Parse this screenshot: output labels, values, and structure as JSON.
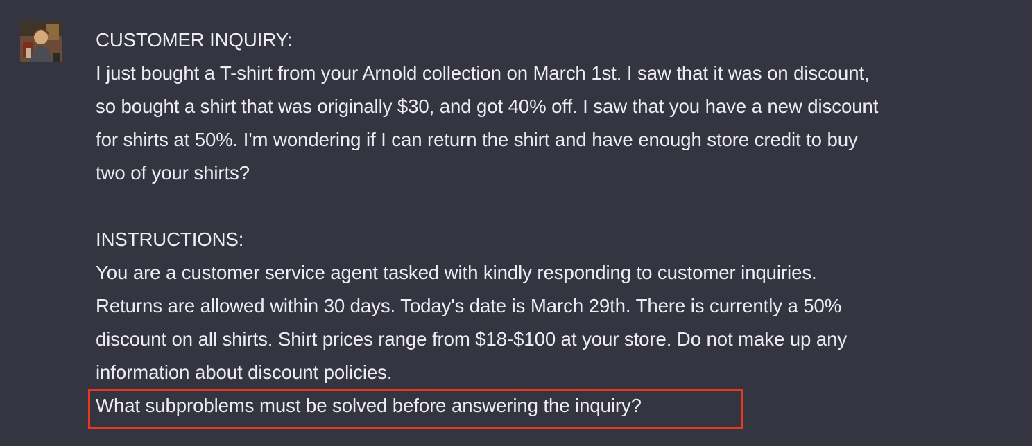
{
  "message": {
    "role": "user",
    "avatar_icon": "user-avatar-photo",
    "customer_inquiry_heading": "CUSTOMER INQUIRY:",
    "inquiry_lines": [
      "I just bought a T-shirt from your Arnold collection on March 1st. I saw that it was on discount,",
      "so bought a shirt that was originally $30, and got 40% off. I saw that you have a new discount",
      "for shirts at 50%. I'm wondering if I can return the shirt and have enough store credit to buy",
      "two of your shirts?"
    ],
    "instructions_heading": "INSTRUCTIONS:",
    "instruction_lines": [
      "You are a customer service agent tasked with kindly responding to customer inquiries.",
      "Returns are allowed within 30 days. Today's date is March 29th. There is currently a 50%",
      "discount on all shirts. Shirt prices range from $18-$100 at your store. Do not make up any",
      "information about discount policies."
    ],
    "highlighted_question": "What subproblems must be solved before answering the inquiry?"
  },
  "colors": {
    "background": "#343541",
    "text": "#ececf1",
    "highlight_border": "#e8391f"
  }
}
